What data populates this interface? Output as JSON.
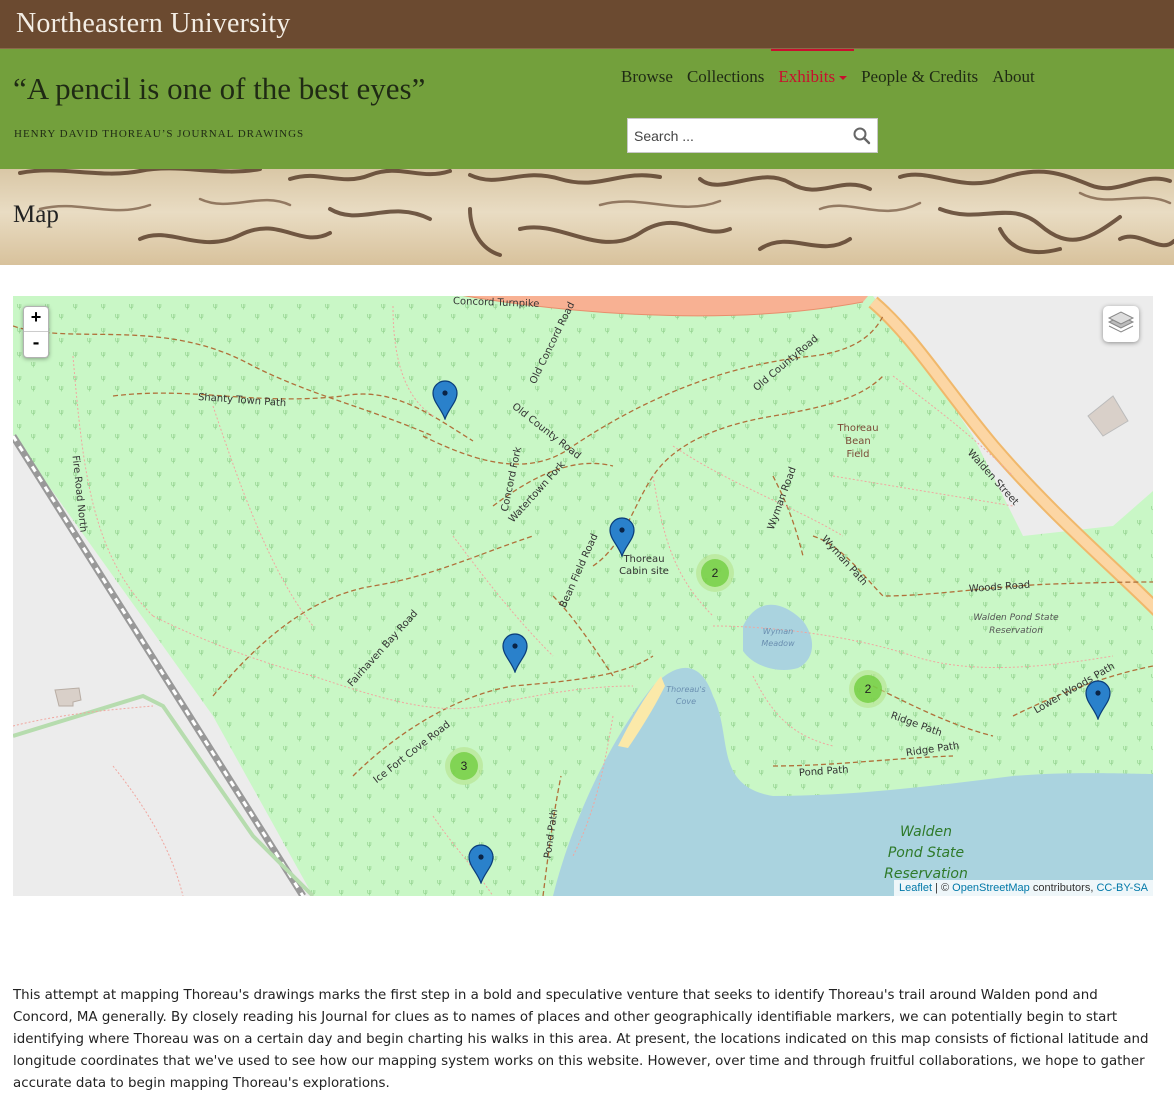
{
  "university": {
    "name": "Northeastern University"
  },
  "site": {
    "title": "“A pencil is one of the best eyes”",
    "subtitle": "HENRY DAVID THOREAU’S JOURNAL DRAWINGS"
  },
  "nav": {
    "items": [
      {
        "label": "Browse"
      },
      {
        "label": "Collections"
      },
      {
        "label": "Exhibits"
      },
      {
        "label": "People & Credits"
      },
      {
        "label": "About"
      }
    ],
    "active": "Exhibits"
  },
  "search": {
    "placeholder": "Search ..."
  },
  "page": {
    "title": "Map"
  },
  "map": {
    "zoom_in": "+",
    "zoom_out": "-",
    "clusters": [
      {
        "count": "2"
      },
      {
        "count": "2"
      },
      {
        "count": "3"
      }
    ],
    "labels": {
      "shanty_town_path": "Shanty Town Path",
      "fire_road_north": "Fire Road North",
      "old_concord_road": "Old Concord Road",
      "old_county_road": "Old County Road",
      "old_countyroad": "Old CountyRoad",
      "concord_fork": "Concord Fork",
      "watertown_fork": "Watertown Fork",
      "bean_field_road": "Bean Field Road",
      "fairhaven_bay_road": "Fairhaven Bay Road",
      "ice_fort_cove_road": "Ice Fort Cove Road",
      "pond_path": "Pond Path",
      "wyman_road": "Wyman Road",
      "wyman_path": "Wyman Path",
      "woods_road": "Woods Road",
      "ridge_path": "Ridge Path",
      "lower_woods_path": "Lower Woods Path",
      "walden_street": "Walden Street",
      "concord_turnpike": "Concord Turnpike",
      "thoreau_bean_field": "Thoreau Bean Field",
      "thoreau_cabin_site": "Thoreau Cabin site",
      "wyman_meadow": "Wyman Meadow",
      "thoreaus_cove": "Thoreau's Cove",
      "walden_pond_sr_small": "Walden Pond State Reservation",
      "walden_pond_sr_large": "Walden Pond State Reservation"
    },
    "attribution": {
      "leaflet": "Leaflet",
      "separator": " | © ",
      "osm": "OpenStreetMap",
      "contributors": " contributors, ",
      "license": "CC-BY-SA"
    }
  },
  "description": "This attempt at mapping Thoreau's drawings marks the first step in a bold and speculative venture that seeks to identify Thoreau's trail around Walden pond and Concord, MA generally. By closely reading his Journal for clues as to names of places and other geographically identifiable markers, we can potentially begin to start identifying where Thoreau was on a certain day and begin charting his walks in this area. At present, the locations indicated on this map consists of fictional latitude and longitude coordinates that we've used to see how our mapping system works on this website. However, over time and through fruitful collaborations, we hope to gather accurate data to begin mapping Thoreau's explorations.",
  "colors": {
    "university_bar": "#6b4a30",
    "header": "#73a03c",
    "nav_active": "#c8102e",
    "forest": "#c9f7c6",
    "water": "#aad3df",
    "road_major": "#f8b193",
    "road_secondary": "#fcd6a4",
    "marker": "#2a81cb",
    "cluster": "#6ecc39"
  }
}
